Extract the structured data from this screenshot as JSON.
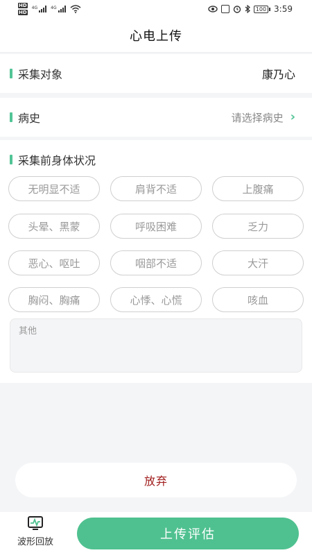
{
  "status_bar": {
    "sim1_label": "HD",
    "sim2_label": "HD",
    "net1": "4G",
    "net2": "4G",
    "battery": "100",
    "time": "3:59"
  },
  "nav": {
    "title": "心电上传"
  },
  "subject": {
    "label": "采集对象",
    "value": "康乃心"
  },
  "history": {
    "label": "病史",
    "placeholder": "请选择病史"
  },
  "symptoms": {
    "label": "采集前身体状况",
    "options": [
      "无明显不适",
      "肩背不适",
      "上腹痛",
      "头晕、黑蒙",
      "呼吸困难",
      "乏力",
      "恶心、呕吐",
      "咽部不适",
      "大汗",
      "胸闷、胸痛",
      "心悸、心慌",
      "咳血"
    ],
    "other_placeholder": "其他"
  },
  "actions": {
    "discard": "放弃",
    "upload": "上传评估"
  },
  "bottom": {
    "replay_label": "波形回放"
  },
  "colors": {
    "accent": "#52c496",
    "danger": "#a11d1d",
    "upload_bg": "#4fc190"
  }
}
